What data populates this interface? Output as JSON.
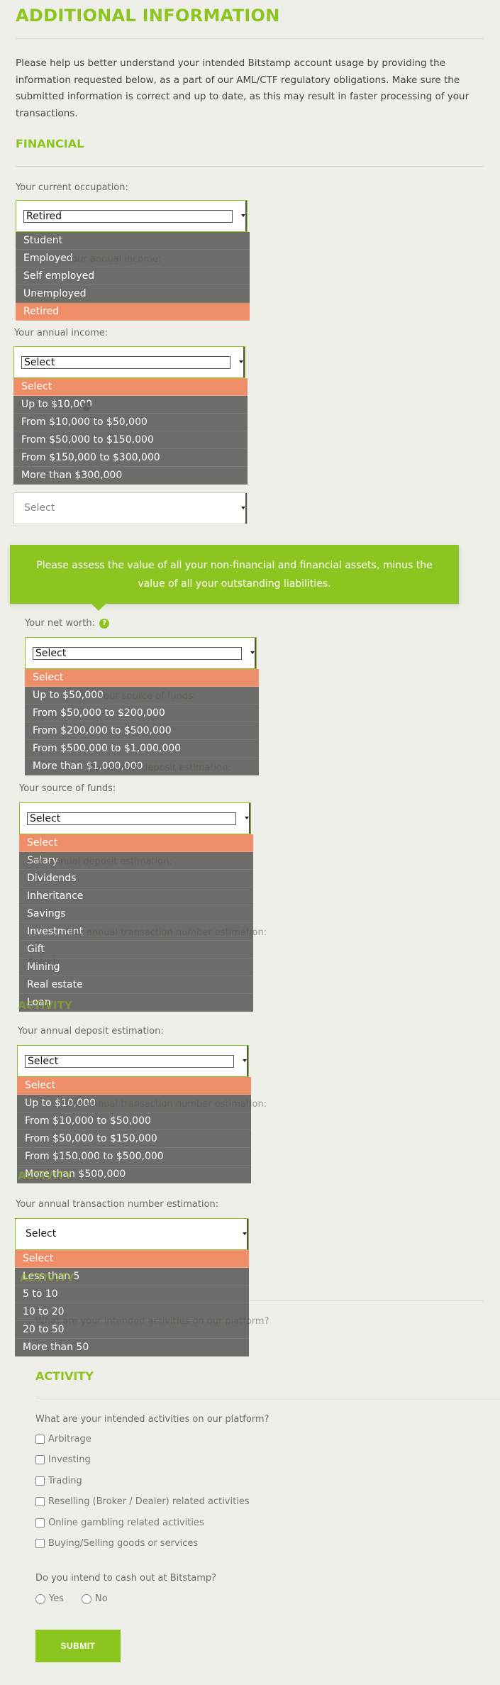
{
  "title": "ADDITIONAL INFORMATION",
  "intro": "Please help us better understand your intended Bitstamp account usage by providing the information requested below, as a part of our AML/CTF regulatory obligations. Make sure the submitted information is correct and up to date, as this may result in faster processing of your transactions.",
  "financial": {
    "heading": "FINANCIAL",
    "occupation": {
      "label": "Your current occupation:",
      "value": "Retired",
      "options": [
        "Student",
        "Employed",
        "Self employed",
        "Unemployed",
        "Retired"
      ],
      "ghost_label": "Your annual income:"
    },
    "income": {
      "label": "Your annual income:",
      "value": "Select",
      "options": [
        "Select",
        "Up to $10,000",
        "From $10,000 to $50,000",
        "From $50,000 to $150,000",
        "From $150,000 to $300,000",
        "More than $300,000"
      ]
    },
    "plain_select": "Select",
    "tooltip": "Please assess the value of all your non-financial and financial assets, minus the value of all your outstanding liabilities.",
    "networth": {
      "label": "Your net worth:",
      "help": "?",
      "value": "Select",
      "options": [
        "Select",
        "Up to $50,000",
        "From $50,000 to $200,000",
        "From $200,000 to $500,000",
        "From $500,000 to $1,000,000",
        "More than $1,000,000"
      ],
      "ghost_label": "Your source of funds:",
      "ghost_label2": "Your annual deposit estimation:"
    },
    "funds": {
      "label": "Your source of funds:",
      "value": "Select",
      "options": [
        "Select",
        "Salary",
        "Dividends",
        "Inheritance",
        "Savings",
        "Investment",
        "Gift",
        "Mining",
        "Real estate",
        "Loan"
      ],
      "ghost_label": "Your annual deposit estimation:",
      "ghost_label2": "Your annual transaction number estimation:",
      "ghost_heading": "ACTIVITY",
      "ghost_select": "Select"
    },
    "deposit": {
      "label": "Your annual deposit estimation:",
      "value": "Select",
      "options": [
        "Select",
        "Up to $10,000",
        "From $10,000 to $50,000",
        "From $50,000 to $150,000",
        "From $150,000 to $500,000",
        "More than $500,000"
      ],
      "ghost_label": "Your annual transaction number estimation:",
      "ghost_heading": "ACTIVITY"
    },
    "transactions": {
      "label": "Your annual transaction number estimation:",
      "value": "Select",
      "options": [
        "Select",
        "Less than 5",
        "5 to 10",
        "10 to 20",
        "20 to 50",
        "More than 50"
      ],
      "ghost_heading": "ACTIVITY",
      "ghost_label": "What are your intended activities on our platform?"
    }
  },
  "activity": {
    "heading": "ACTIVITY",
    "question": "What are your intended activities on our platform?",
    "options": [
      "Arbitrage",
      "Investing",
      "Trading",
      "Reselling (Broker / Dealer) related activities",
      "Online gambling related activities",
      "Buying/Selling goods or services"
    ],
    "cashout_question": "Do you intend to cash out at Bitstamp?",
    "yes": "Yes",
    "no": "No",
    "submit": "SUBMIT"
  }
}
